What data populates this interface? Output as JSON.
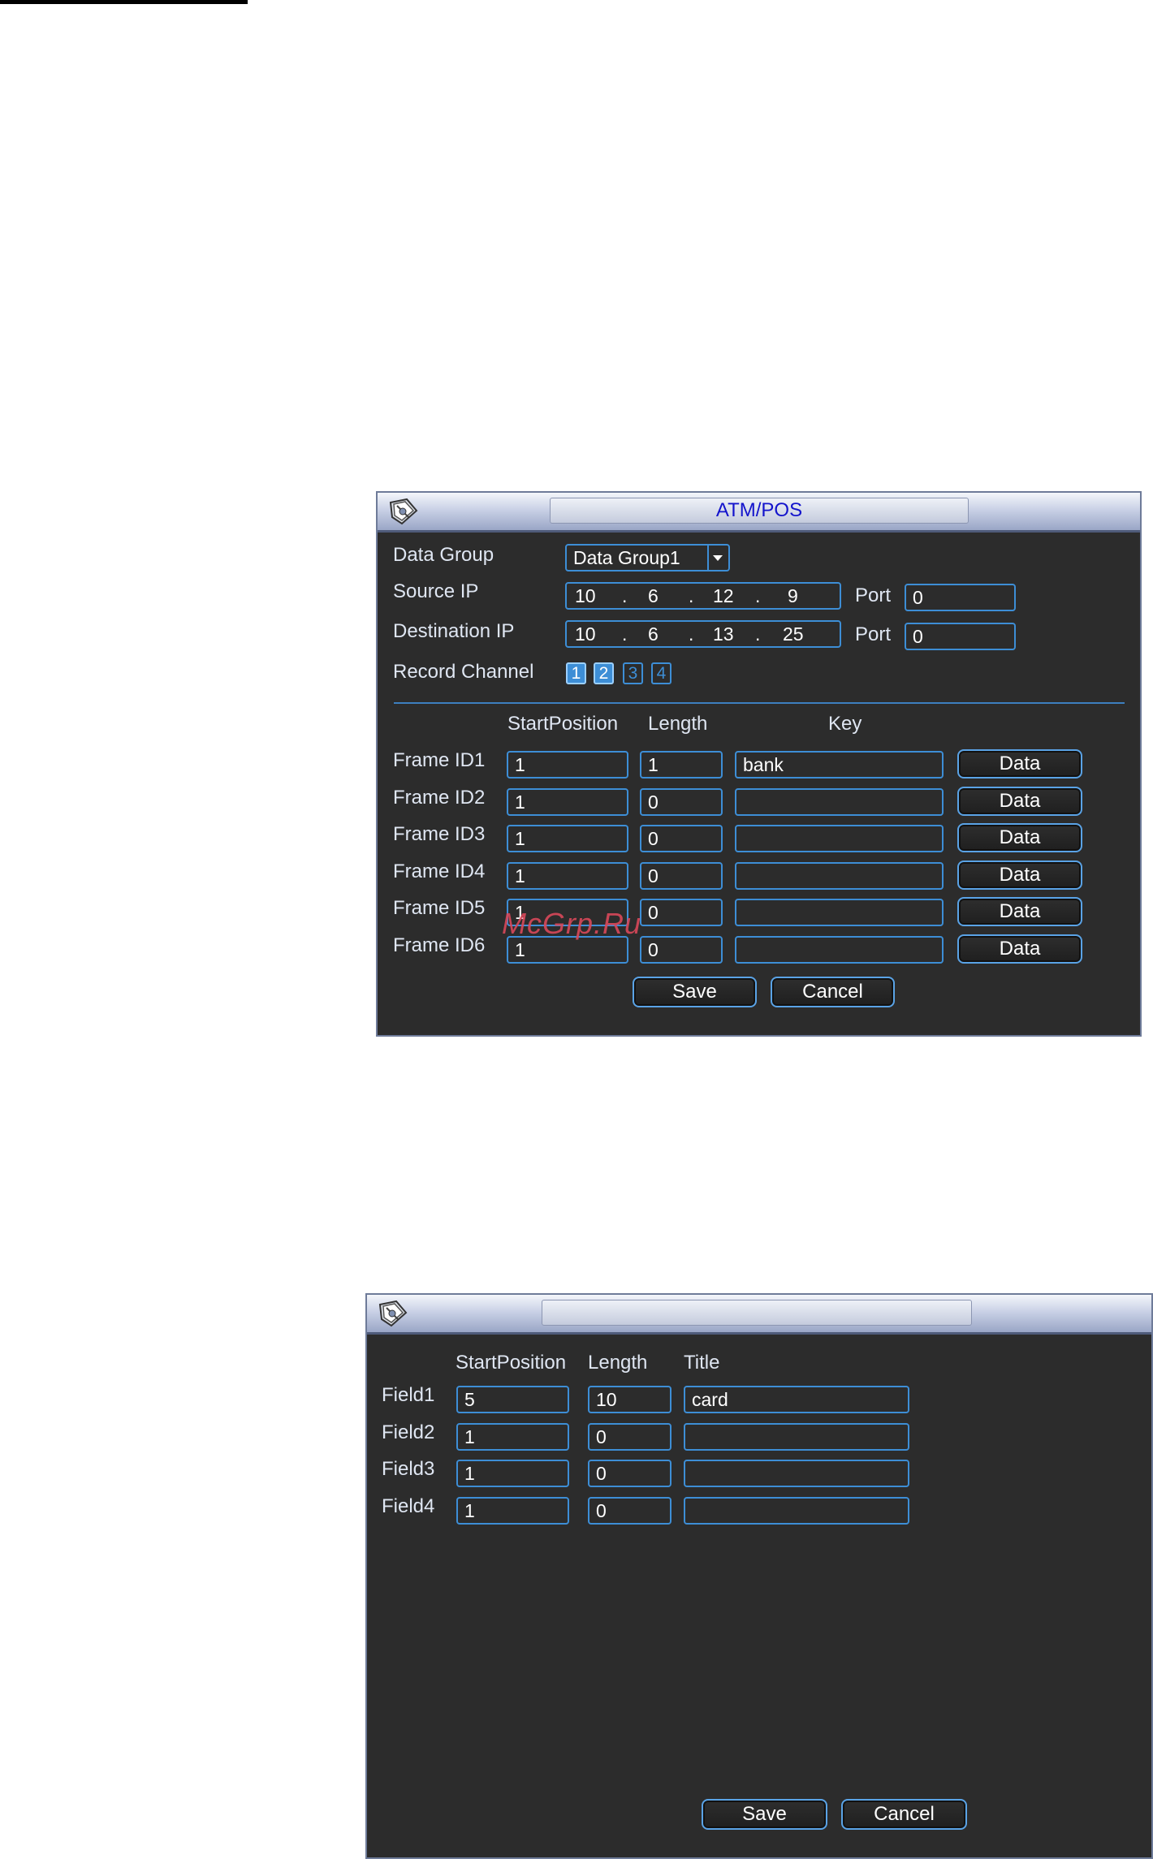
{
  "atm_pos": {
    "title": "ATM/POS",
    "data_group_label": "Data Group",
    "data_group_value": "Data Group1",
    "source_ip_label": "Source IP",
    "source_ip": [
      "10",
      "6",
      "12",
      "9"
    ],
    "destination_ip_label": "Destination IP",
    "destination_ip": [
      "10",
      "6",
      "13",
      "25"
    ],
    "ip_dot": ".",
    "port_label": "Port",
    "source_port": "0",
    "destination_port": "0",
    "record_channel_label": "Record Channel",
    "channels": [
      {
        "label": "1",
        "checked": true
      },
      {
        "label": "2",
        "checked": true
      },
      {
        "label": "3",
        "checked": false
      },
      {
        "label": "4",
        "checked": false
      }
    ],
    "columns": {
      "start": "StartPosition",
      "length": "Length",
      "key": "Key"
    },
    "frames": [
      {
        "label": "Frame ID1",
        "start": "1",
        "length": "1",
        "key": "bank",
        "button": "Data"
      },
      {
        "label": "Frame ID2",
        "start": "1",
        "length": "0",
        "key": "",
        "button": "Data"
      },
      {
        "label": "Frame ID3",
        "start": "1",
        "length": "0",
        "key": "",
        "button": "Data"
      },
      {
        "label": "Frame ID4",
        "start": "1",
        "length": "0",
        "key": "",
        "button": "Data"
      },
      {
        "label": "Frame ID5",
        "start": "1",
        "length": "0",
        "key": "",
        "button": "Data"
      },
      {
        "label": "Frame ID6",
        "start": "1",
        "length": "0",
        "key": "",
        "button": "Data"
      }
    ],
    "save_label": "Save",
    "cancel_label": "Cancel"
  },
  "data_dialog": {
    "columns": {
      "start": "StartPosition",
      "length": "Length",
      "title": "Title"
    },
    "fields": [
      {
        "label": "Field1",
        "start": "5",
        "length": "10",
        "title": "card"
      },
      {
        "label": "Field2",
        "start": "1",
        "length": "0",
        "title": ""
      },
      {
        "label": "Field3",
        "start": "1",
        "length": "0",
        "title": ""
      },
      {
        "label": "Field4",
        "start": "1",
        "length": "0",
        "title": ""
      }
    ],
    "save_label": "Save",
    "cancel_label": "Cancel"
  },
  "watermark": "McGrp.Ru",
  "colors": {
    "accent": "#3d8ed6",
    "panel_bg": "#2c2c2c",
    "title_text": "#1414cc",
    "label_text": "#dfe6f2"
  }
}
